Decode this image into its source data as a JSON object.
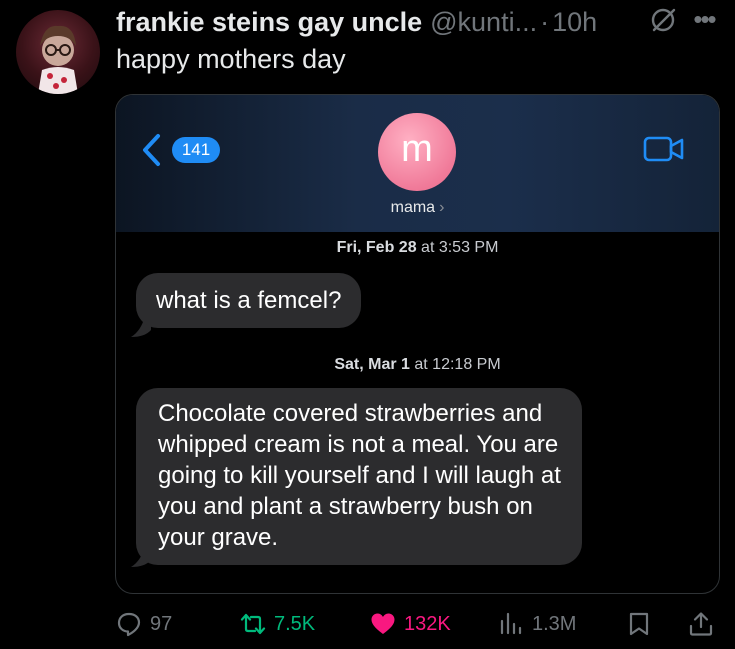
{
  "tweet": {
    "display_name": "frankie steins gay uncle",
    "handle": "@kunti...",
    "separator": "·",
    "time": "10h",
    "text": "happy mothers day"
  },
  "media": {
    "unread_count": "141",
    "contact_initial": "m",
    "contact_name": "mama",
    "contact_chevron": "›",
    "messages": [
      {
        "date": "Fri, Feb 28",
        "at": " at ",
        "time": "3:53 PM",
        "text": "what is a femcel?"
      },
      {
        "date": "Sat, Mar 1",
        "at": " at ",
        "time": "12:18 PM",
        "text": "Chocolate covered strawberries and whipped cream is not a meal. You are going to kill yourself and I will laugh at you and plant a strawberry bush on your grave."
      }
    ]
  },
  "actions": {
    "replies": "97",
    "reposts": "7.5K",
    "likes": "132K",
    "views": "1.3M"
  },
  "icons": {
    "reply": "reply-icon",
    "repost": "repost-icon",
    "like": "heart-icon",
    "views": "views-icon",
    "bookmark": "bookmark-icon",
    "share": "share-icon",
    "more": "more-icon",
    "grok": "grok-icon",
    "back": "chevron-left-icon",
    "video": "video-call-icon"
  },
  "colors": {
    "background": "#000000",
    "text": "#e7e9ea",
    "muted": "#71767b",
    "repost": "#00ba7c",
    "like": "#f91880",
    "bubble": "#2c2c2e",
    "badge": "#1f8cf5",
    "contact_avatar": "#f07a99"
  }
}
